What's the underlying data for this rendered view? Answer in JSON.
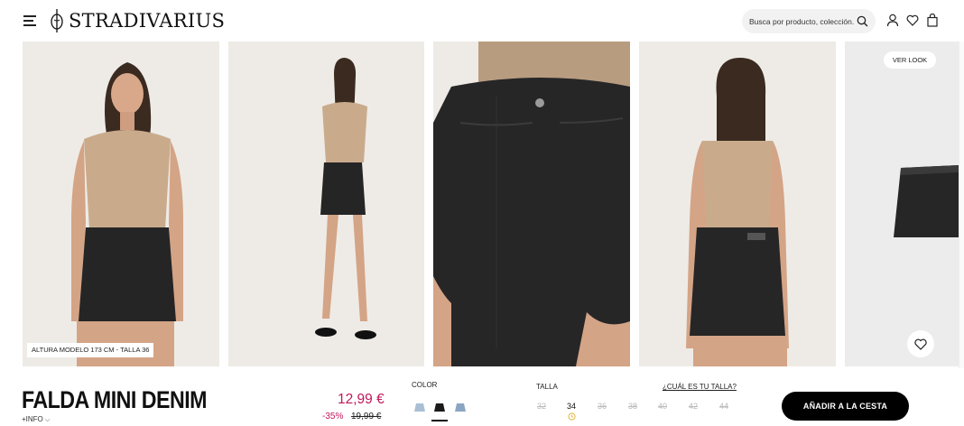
{
  "header": {
    "brand": "STRADIVARIUS",
    "search_placeholder": "Busca por producto, colección..."
  },
  "gallery": {
    "model_info": "ALTURA MODELO 173 CM - TALLA 36",
    "see_look_label": "VER LOOK"
  },
  "product": {
    "title": "FALDA MINI DENIM",
    "more_info": "+INFO",
    "price": "12,99 €",
    "discount": "-35%",
    "old_price": "19,99 €",
    "color_label": "COLOR",
    "size_label": "TALLA",
    "size_guide": "¿CUÁL ES TU TALLA?",
    "sizes": [
      "32",
      "34",
      "36",
      "38",
      "40",
      "42",
      "44"
    ],
    "available_sizes": [
      "34"
    ],
    "add_to_cart": "AÑADIR A LA CESTA"
  },
  "colors": {
    "price_accent": "#c2185b",
    "swatches": [
      "#a9bfd4",
      "#1b1b1b",
      "#8ba6c2"
    ]
  },
  "icons": [
    "menu-icon",
    "search-icon",
    "user-icon",
    "heart-icon",
    "bag-icon",
    "clock-icon"
  ]
}
